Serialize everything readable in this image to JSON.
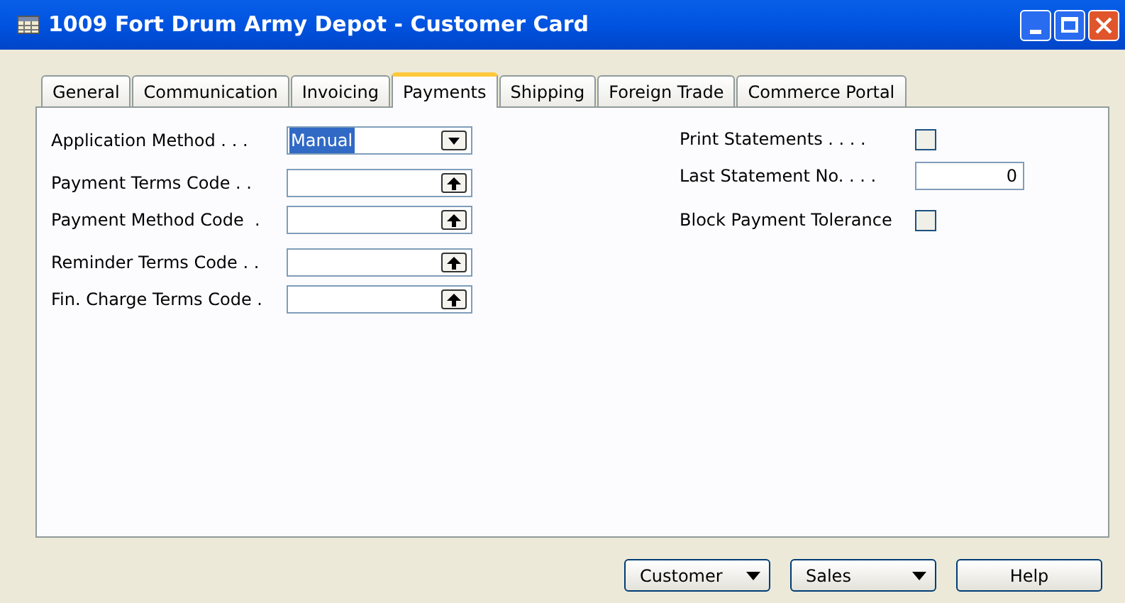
{
  "window": {
    "title": "1009 Fort Drum Army Depot - Customer Card"
  },
  "tabs": [
    {
      "label": "General",
      "selected": false
    },
    {
      "label": "Communication",
      "selected": false
    },
    {
      "label": "Invoicing",
      "selected": false
    },
    {
      "label": "Payments",
      "selected": true
    },
    {
      "label": "Shipping",
      "selected": false
    },
    {
      "label": "Foreign Trade",
      "selected": false
    },
    {
      "label": "Commerce Portal",
      "selected": false
    }
  ],
  "left_fields": [
    {
      "kind": "dropdown",
      "label": "Application Method . . .",
      "value": "Manual",
      "highlighted": true
    },
    {
      "kind": "lookup",
      "label": "Payment Terms Code . ."
    },
    {
      "kind": "lookup",
      "label": "Payment Method Code  ."
    },
    {
      "kind": "lookup",
      "label": "Reminder Terms Code . ."
    },
    {
      "kind": "lookup",
      "label": "Fin. Charge Terms Code ."
    }
  ],
  "right_fields": [
    {
      "kind": "checkbox",
      "label": "Print Statements . . . .",
      "checked": false
    },
    {
      "kind": "number",
      "label": "Last Statement No. . . .",
      "value": "0"
    },
    {
      "kind": "checkbox",
      "label": "Block Payment Tolerance",
      "checked": false
    }
  ],
  "buttons": [
    {
      "kind": "menu",
      "label": "Customer"
    },
    {
      "kind": "menu",
      "label": "Sales"
    },
    {
      "kind": "plain",
      "label": "Help"
    }
  ]
}
